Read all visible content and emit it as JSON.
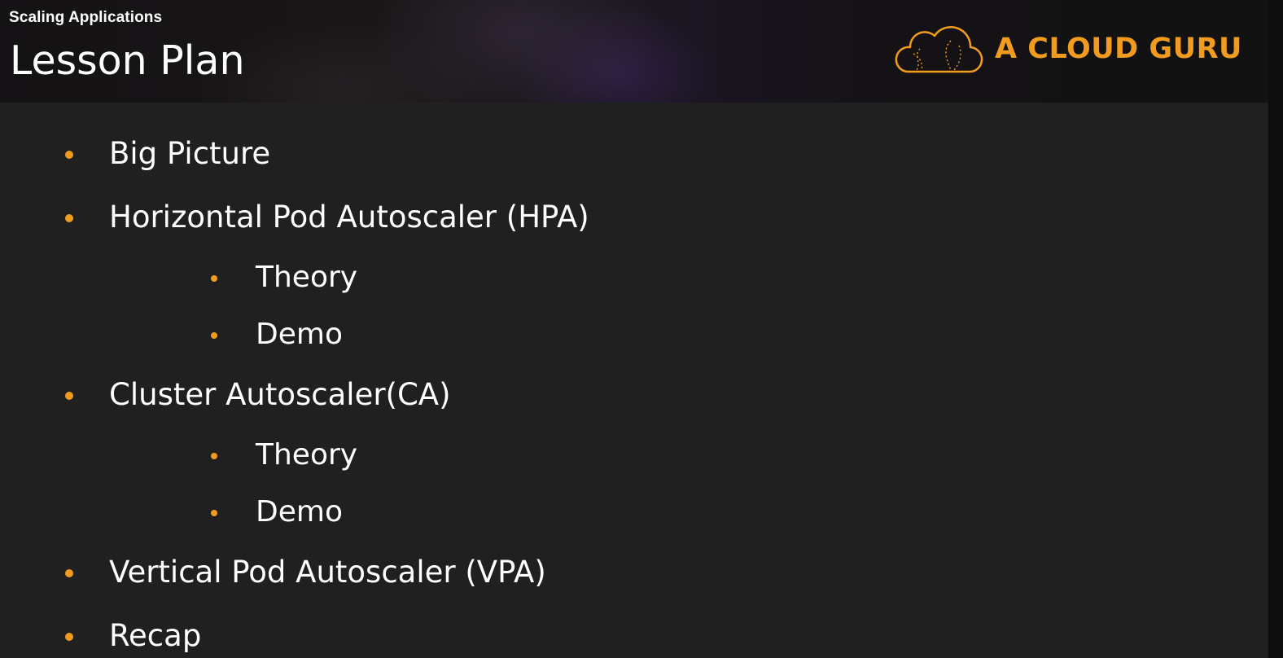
{
  "header": {
    "section_label": "Scaling Applications",
    "title": "Lesson Plan",
    "brand_name": "A CLOUD GURU",
    "brand_icon": "cloud-logo-icon",
    "accent_color": "#f19b1f"
  },
  "outline": [
    {
      "label": "Big Picture",
      "level": 1
    },
    {
      "label": "Horizontal Pod Autoscaler (HPA)",
      "level": 1
    },
    {
      "label": "Theory",
      "level": 2
    },
    {
      "label": "Demo",
      "level": 2
    },
    {
      "label": "Cluster Autoscaler(CA)",
      "level": 1
    },
    {
      "label": "Theory",
      "level": 2
    },
    {
      "label": "Demo",
      "level": 2
    },
    {
      "label": "Vertical Pod Autoscaler (VPA)",
      "level": 1
    },
    {
      "label": "Recap",
      "level": 1
    }
  ]
}
